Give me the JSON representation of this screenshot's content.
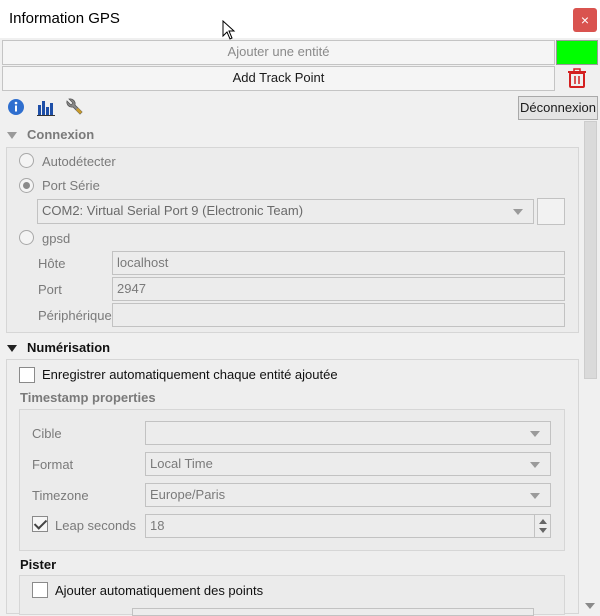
{
  "window": {
    "title": "Information GPS",
    "close": "×"
  },
  "toolbar": {
    "add_feature": "Ajouter une entité",
    "add_track_point": "Add Track Point",
    "disconnect": "Déconnexion",
    "icons": [
      "info-icon",
      "histogram-icon",
      "wrench-icon",
      "trash-icon"
    ],
    "status_color": "#00ff00"
  },
  "connection": {
    "heading": "Connexion",
    "autodetect": "Autodétecter",
    "serial_port": "Port Série",
    "serial_selected": "COM2: Virtual Serial Port 9 (Electronic Team)",
    "gpsd": "gpsd",
    "host_label": "Hôte",
    "host_value": "localhost",
    "port_label": "Port",
    "port_value": "2947",
    "device_label": "Périphérique",
    "device_value": ""
  },
  "digitizing": {
    "heading": "Numérisation",
    "auto_save": "Enregistrer automatiquement chaque entité ajoutée",
    "timestamp_heading": "Timestamp properties",
    "target_label": "Cible",
    "target_value": "",
    "format_label": "Format",
    "format_value": "Local Time",
    "timezone_label": "Timezone",
    "timezone_value": "Europe/Paris",
    "leap_label": "Leap seconds",
    "leap_value": "18",
    "leap_checked": true
  },
  "tracking": {
    "heading": "Pister",
    "auto_add_points": "Ajouter automatiquement des points"
  }
}
